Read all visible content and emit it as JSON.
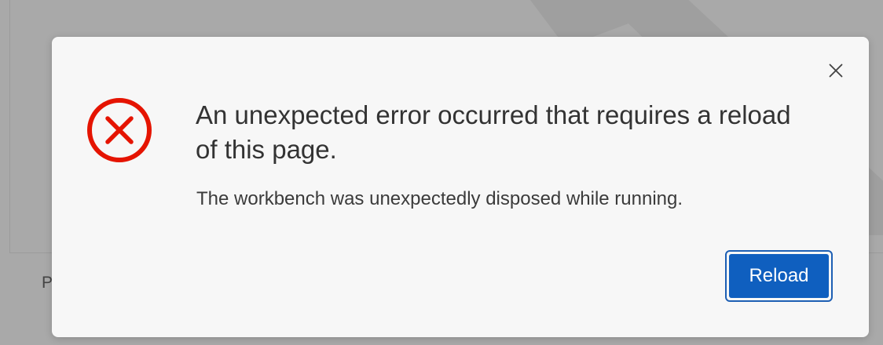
{
  "background": {
    "partial_text": "P"
  },
  "dialog": {
    "title": "An unexpected error occurred that requires a reload of this page.",
    "detail": "The workbench was unexpectedly disposed while running.",
    "icon": "error-circle-x-icon",
    "close_icon": "close-icon",
    "reload_label": "Reload",
    "colors": {
      "error_red": "#e51400",
      "primary_button": "#0f5fbf",
      "focus_ring": "#1d5fb4"
    }
  }
}
